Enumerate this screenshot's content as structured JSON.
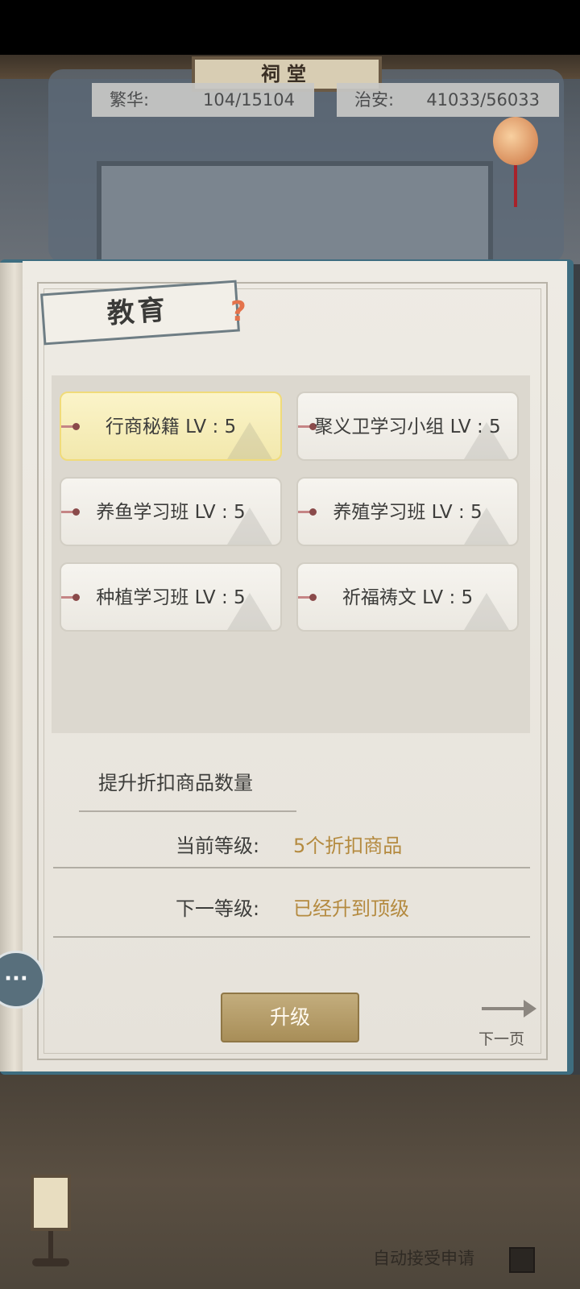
{
  "header": {
    "plaque_title": "祠堂",
    "prosperity": {
      "label": "繁华:",
      "value": "104/15104"
    },
    "security": {
      "label": "治安:",
      "value": "41033/56033"
    }
  },
  "book": {
    "title": "教育",
    "help_glyph": "?",
    "cards": [
      {
        "label": "行商秘籍 LV : 5",
        "selected": true
      },
      {
        "label": "聚义卫学习小组 LV : 5",
        "selected": false
      },
      {
        "label": "养鱼学习班 LV : 5",
        "selected": false
      },
      {
        "label": "养殖学习班 LV : 5",
        "selected": false
      },
      {
        "label": "种植学习班 LV : 5",
        "selected": false
      },
      {
        "label": "祈福祷文 LV : 5",
        "selected": false
      }
    ],
    "description": "提升折扣商品数量",
    "current_level": {
      "label": "当前等级:",
      "value": "5个折扣商品"
    },
    "next_level": {
      "label": "下一等级:",
      "value": "已经升到顶级"
    },
    "upgrade_button": "升级",
    "next_page": "下一页"
  },
  "chat_glyph": "···",
  "footer": {
    "auto_accept_label": "自动接受申请"
  }
}
